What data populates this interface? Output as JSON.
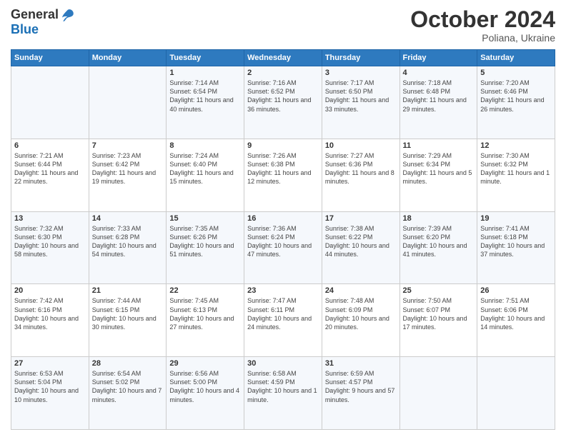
{
  "header": {
    "logo_line1": "General",
    "logo_line2": "Blue",
    "month_title": "October 2024",
    "subtitle": "Poliana, Ukraine"
  },
  "weekdays": [
    "Sunday",
    "Monday",
    "Tuesday",
    "Wednesday",
    "Thursday",
    "Friday",
    "Saturday"
  ],
  "weeks": [
    [
      {
        "day": "",
        "sunrise": "",
        "sunset": "",
        "daylight": ""
      },
      {
        "day": "",
        "sunrise": "",
        "sunset": "",
        "daylight": ""
      },
      {
        "day": "1",
        "sunrise": "Sunrise: 7:14 AM",
        "sunset": "Sunset: 6:54 PM",
        "daylight": "Daylight: 11 hours and 40 minutes."
      },
      {
        "day": "2",
        "sunrise": "Sunrise: 7:16 AM",
        "sunset": "Sunset: 6:52 PM",
        "daylight": "Daylight: 11 hours and 36 minutes."
      },
      {
        "day": "3",
        "sunrise": "Sunrise: 7:17 AM",
        "sunset": "Sunset: 6:50 PM",
        "daylight": "Daylight: 11 hours and 33 minutes."
      },
      {
        "day": "4",
        "sunrise": "Sunrise: 7:18 AM",
        "sunset": "Sunset: 6:48 PM",
        "daylight": "Daylight: 11 hours and 29 minutes."
      },
      {
        "day": "5",
        "sunrise": "Sunrise: 7:20 AM",
        "sunset": "Sunset: 6:46 PM",
        "daylight": "Daylight: 11 hours and 26 minutes."
      }
    ],
    [
      {
        "day": "6",
        "sunrise": "Sunrise: 7:21 AM",
        "sunset": "Sunset: 6:44 PM",
        "daylight": "Daylight: 11 hours and 22 minutes."
      },
      {
        "day": "7",
        "sunrise": "Sunrise: 7:23 AM",
        "sunset": "Sunset: 6:42 PM",
        "daylight": "Daylight: 11 hours and 19 minutes."
      },
      {
        "day": "8",
        "sunrise": "Sunrise: 7:24 AM",
        "sunset": "Sunset: 6:40 PM",
        "daylight": "Daylight: 11 hours and 15 minutes."
      },
      {
        "day": "9",
        "sunrise": "Sunrise: 7:26 AM",
        "sunset": "Sunset: 6:38 PM",
        "daylight": "Daylight: 11 hours and 12 minutes."
      },
      {
        "day": "10",
        "sunrise": "Sunrise: 7:27 AM",
        "sunset": "Sunset: 6:36 PM",
        "daylight": "Daylight: 11 hours and 8 minutes."
      },
      {
        "day": "11",
        "sunrise": "Sunrise: 7:29 AM",
        "sunset": "Sunset: 6:34 PM",
        "daylight": "Daylight: 11 hours and 5 minutes."
      },
      {
        "day": "12",
        "sunrise": "Sunrise: 7:30 AM",
        "sunset": "Sunset: 6:32 PM",
        "daylight": "Daylight: 11 hours and 1 minute."
      }
    ],
    [
      {
        "day": "13",
        "sunrise": "Sunrise: 7:32 AM",
        "sunset": "Sunset: 6:30 PM",
        "daylight": "Daylight: 10 hours and 58 minutes."
      },
      {
        "day": "14",
        "sunrise": "Sunrise: 7:33 AM",
        "sunset": "Sunset: 6:28 PM",
        "daylight": "Daylight: 10 hours and 54 minutes."
      },
      {
        "day": "15",
        "sunrise": "Sunrise: 7:35 AM",
        "sunset": "Sunset: 6:26 PM",
        "daylight": "Daylight: 10 hours and 51 minutes."
      },
      {
        "day": "16",
        "sunrise": "Sunrise: 7:36 AM",
        "sunset": "Sunset: 6:24 PM",
        "daylight": "Daylight: 10 hours and 47 minutes."
      },
      {
        "day": "17",
        "sunrise": "Sunrise: 7:38 AM",
        "sunset": "Sunset: 6:22 PM",
        "daylight": "Daylight: 10 hours and 44 minutes."
      },
      {
        "day": "18",
        "sunrise": "Sunrise: 7:39 AM",
        "sunset": "Sunset: 6:20 PM",
        "daylight": "Daylight: 10 hours and 41 minutes."
      },
      {
        "day": "19",
        "sunrise": "Sunrise: 7:41 AM",
        "sunset": "Sunset: 6:18 PM",
        "daylight": "Daylight: 10 hours and 37 minutes."
      }
    ],
    [
      {
        "day": "20",
        "sunrise": "Sunrise: 7:42 AM",
        "sunset": "Sunset: 6:16 PM",
        "daylight": "Daylight: 10 hours and 34 minutes."
      },
      {
        "day": "21",
        "sunrise": "Sunrise: 7:44 AM",
        "sunset": "Sunset: 6:15 PM",
        "daylight": "Daylight: 10 hours and 30 minutes."
      },
      {
        "day": "22",
        "sunrise": "Sunrise: 7:45 AM",
        "sunset": "Sunset: 6:13 PM",
        "daylight": "Daylight: 10 hours and 27 minutes."
      },
      {
        "day": "23",
        "sunrise": "Sunrise: 7:47 AM",
        "sunset": "Sunset: 6:11 PM",
        "daylight": "Daylight: 10 hours and 24 minutes."
      },
      {
        "day": "24",
        "sunrise": "Sunrise: 7:48 AM",
        "sunset": "Sunset: 6:09 PM",
        "daylight": "Daylight: 10 hours and 20 minutes."
      },
      {
        "day": "25",
        "sunrise": "Sunrise: 7:50 AM",
        "sunset": "Sunset: 6:07 PM",
        "daylight": "Daylight: 10 hours and 17 minutes."
      },
      {
        "day": "26",
        "sunrise": "Sunrise: 7:51 AM",
        "sunset": "Sunset: 6:06 PM",
        "daylight": "Daylight: 10 hours and 14 minutes."
      }
    ],
    [
      {
        "day": "27",
        "sunrise": "Sunrise: 6:53 AM",
        "sunset": "Sunset: 5:04 PM",
        "daylight": "Daylight: 10 hours and 10 minutes."
      },
      {
        "day": "28",
        "sunrise": "Sunrise: 6:54 AM",
        "sunset": "Sunset: 5:02 PM",
        "daylight": "Daylight: 10 hours and 7 minutes."
      },
      {
        "day": "29",
        "sunrise": "Sunrise: 6:56 AM",
        "sunset": "Sunset: 5:00 PM",
        "daylight": "Daylight: 10 hours and 4 minutes."
      },
      {
        "day": "30",
        "sunrise": "Sunrise: 6:58 AM",
        "sunset": "Sunset: 4:59 PM",
        "daylight": "Daylight: 10 hours and 1 minute."
      },
      {
        "day": "31",
        "sunrise": "Sunrise: 6:59 AM",
        "sunset": "Sunset: 4:57 PM",
        "daylight": "Daylight: 9 hours and 57 minutes."
      },
      {
        "day": "",
        "sunrise": "",
        "sunset": "",
        "daylight": ""
      },
      {
        "day": "",
        "sunrise": "",
        "sunset": "",
        "daylight": ""
      }
    ]
  ]
}
